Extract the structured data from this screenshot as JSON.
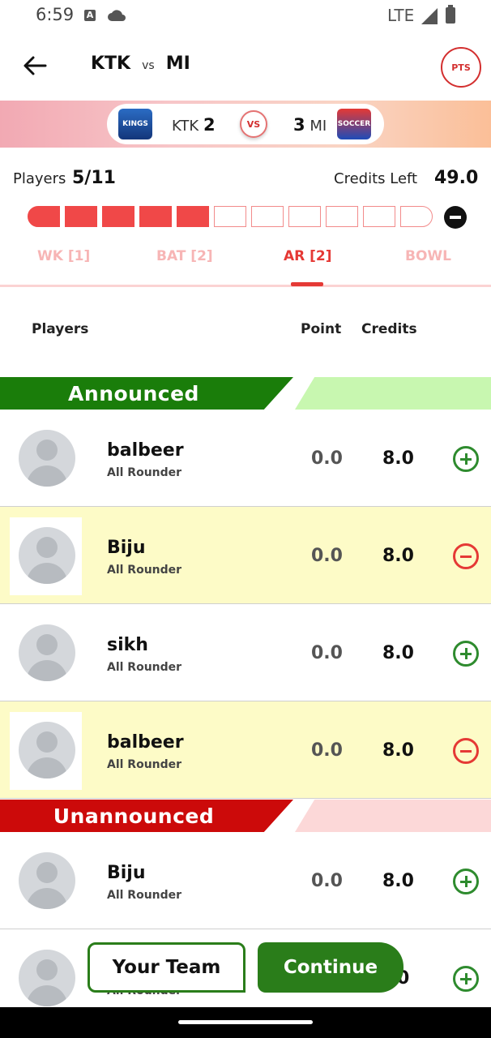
{
  "status_bar": {
    "time": "6:59",
    "network": "LTE",
    "a_badge": "A"
  },
  "header": {
    "team_a": "KTK",
    "vs_label": "vs",
    "team_b": "MI",
    "pts_label": "PTS"
  },
  "score_banner": {
    "team_a_short": "KTK",
    "team_a_score": "2",
    "vs_label": "VS",
    "team_b_score": "3",
    "team_b_short": "MI",
    "team_a_logo_text": "KINGS",
    "team_b_logo_text": "SOCCER"
  },
  "summary": {
    "players_label": "Players",
    "players_value": "5/11",
    "credits_label": "Credits Left",
    "credits_value": "49.0",
    "selected_fraction": 0.4545
  },
  "tabs": [
    {
      "label": "WK [1]",
      "active": false
    },
    {
      "label": "BAT [2]",
      "active": false
    },
    {
      "label": "AR [2]",
      "active": true
    },
    {
      "label": "BOWL",
      "active": false
    }
  ],
  "columns": {
    "players": "Players",
    "point": "Point",
    "credits": "Credits"
  },
  "sections": {
    "announced": {
      "label": "Announced",
      "color": "#1a7d0a",
      "tail_color": "#c8f7b0"
    },
    "unannounced": {
      "label": "Unannounced",
      "color": "#cc0a0a",
      "tail_color": "#fcd8d8"
    }
  },
  "players": [
    {
      "name": "balbeer",
      "role": "All Rounder",
      "point": "0.0",
      "credits": "8.0",
      "selected": false
    },
    {
      "name": "Biju",
      "role": "All Rounder",
      "point": "0.0",
      "credits": "8.0",
      "selected": true
    },
    {
      "name": "sikh",
      "role": "All Rounder",
      "point": "0.0",
      "credits": "8.0",
      "selected": false
    },
    {
      "name": "balbeer",
      "role": "All Rounder",
      "point": "0.0",
      "credits": "8.0",
      "selected": true
    },
    {
      "name": "Biju",
      "role": "All Rounder",
      "point": "0.0",
      "credits": "8.0",
      "selected": false
    },
    {
      "name": "",
      "role": "All Rounder",
      "point": "",
      "credits": "0",
      "selected": false
    }
  ],
  "buttons": {
    "your_team": "Your Team",
    "continue": "Continue"
  },
  "colors": {
    "accent_red": "#e53935",
    "accent_green": "#2a7d1a",
    "progress_fill": "#f04848"
  }
}
